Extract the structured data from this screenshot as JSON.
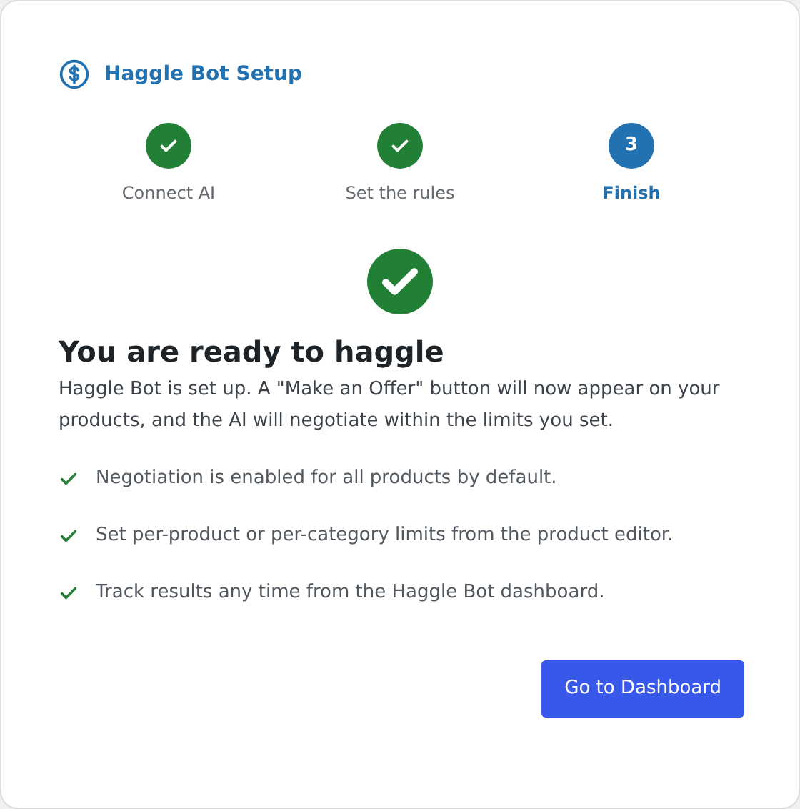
{
  "header": {
    "title": "Haggle Bot Setup"
  },
  "steps": [
    {
      "label": "Connect AI",
      "kind": "complete"
    },
    {
      "label": "Set the rules",
      "kind": "complete"
    },
    {
      "label": "Finish",
      "kind": "current",
      "number": "3"
    }
  ],
  "success": {
    "heading": "You are ready to haggle",
    "description": "Haggle Bot is set up. A \"Make an Offer\" button will now appear on your products, and the AI will negotiate within the limits you set."
  },
  "checklist": [
    "Negotiation is enabled for all products by default.",
    "Set per-product or per-category limits from the product editor.",
    "Track results any time from the Haggle Bot dashboard."
  ],
  "button": "Go to Dashboard"
}
